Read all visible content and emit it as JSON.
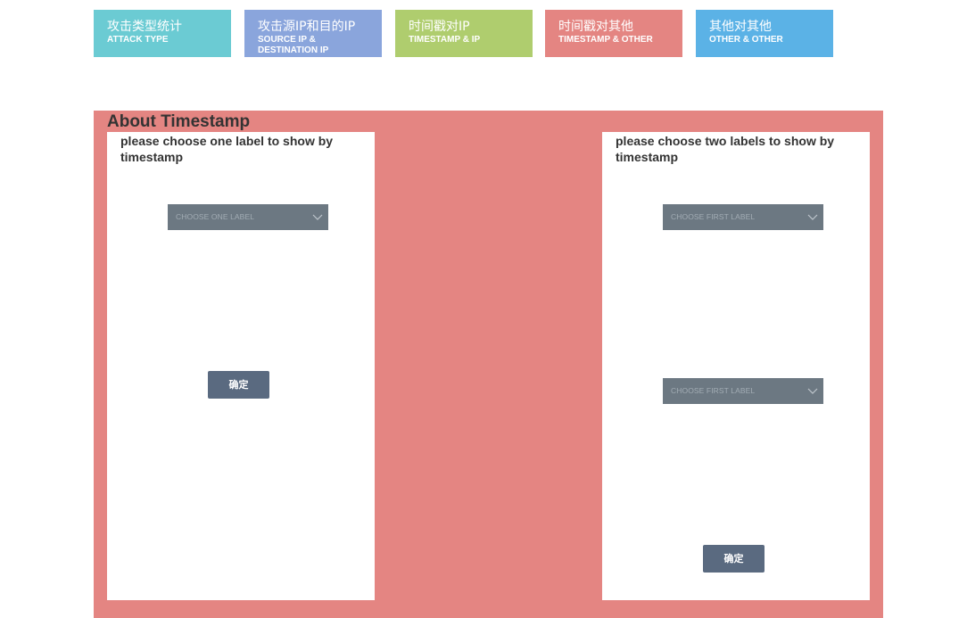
{
  "nav": {
    "tiles": [
      {
        "cn": "攻击类型统计",
        "en": "ATTACK TYPE",
        "color": "#6bcbd3"
      },
      {
        "cn": "攻击源IP和目的IP",
        "en": "SOURCE IP & DESTINATION IP",
        "color": "#8aa5dc"
      },
      {
        "cn": "时间戳对IP",
        "en": "TIMESTAMP & IP",
        "color": "#afcd6e"
      },
      {
        "cn": "时间戳对其他",
        "en": "TIMESTAMP & OTHER",
        "color": "#e48582"
      },
      {
        "cn": "其他对其他",
        "en": "OTHER & OTHER",
        "color": "#5bb2e6"
      }
    ]
  },
  "panel": {
    "title": "About Timestamp",
    "background": "#e48582"
  },
  "left_card": {
    "heading": "please choose one label to show by timestamp",
    "select_placeholder": "CHOOSE ONE LABEL",
    "confirm_label": "确定"
  },
  "right_card": {
    "heading": "please choose two labels to show by timestamp",
    "select_first_placeholder": "CHOOSE FIRST LABEL",
    "select_second_placeholder": "CHOOSE FIRST LABEL",
    "confirm_label": "确定"
  },
  "colors": {
    "select_bg": "#6c7882",
    "select_text": "#a2acb4",
    "chevron": "#bfc6cc",
    "button_bg": "#5a6a80"
  }
}
